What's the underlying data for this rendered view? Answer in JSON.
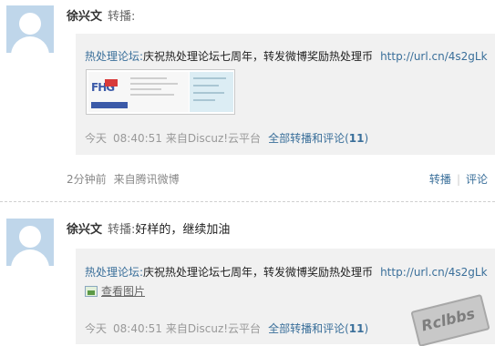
{
  "posts": [
    {
      "author": "徐兴文",
      "verb": "转播:",
      "text": "",
      "quote": {
        "author": "热处理论坛:",
        "text": "庆祝热处理论坛七周年，转发微博奖励热处理币",
        "link": "http://url.cn/4s2gLk",
        "meta_day": "今天",
        "meta_time": "08:40:51",
        "meta_source": "来自Discuz!云平台",
        "all_label": "全部转播和评论",
        "count_open": "(",
        "count": "11",
        "count_close": ")"
      },
      "footer": {
        "time_ago": "2分钟前",
        "source": "来自腾讯微博",
        "repost_label": "转播",
        "comment_label": "评论",
        "separator": "|"
      }
    },
    {
      "author": "徐兴文",
      "verb": "转播:",
      "text": "好样的，继续加油",
      "quote": {
        "author": "热处理论坛:",
        "text": "庆祝热处理论坛七周年，转发微博奖励热处理币",
        "link": "http://url.cn/4s2gLk",
        "view_image_label": "查看图片",
        "meta_day": "今天",
        "meta_time": "08:40:51",
        "meta_source": "来自Discuz!云平台",
        "all_label": "全部转播和评论",
        "count_open": "(",
        "count": "11",
        "count_close": ")"
      }
    }
  ],
  "watermark": "Rclbbs",
  "colors": {
    "link": "#3a6f9a",
    "quote_bg": "#f1f1f1",
    "avatar_bg": "#bfd6ea",
    "meta": "#999999"
  },
  "icons": [
    "default-avatar-icon",
    "image-icon"
  ]
}
